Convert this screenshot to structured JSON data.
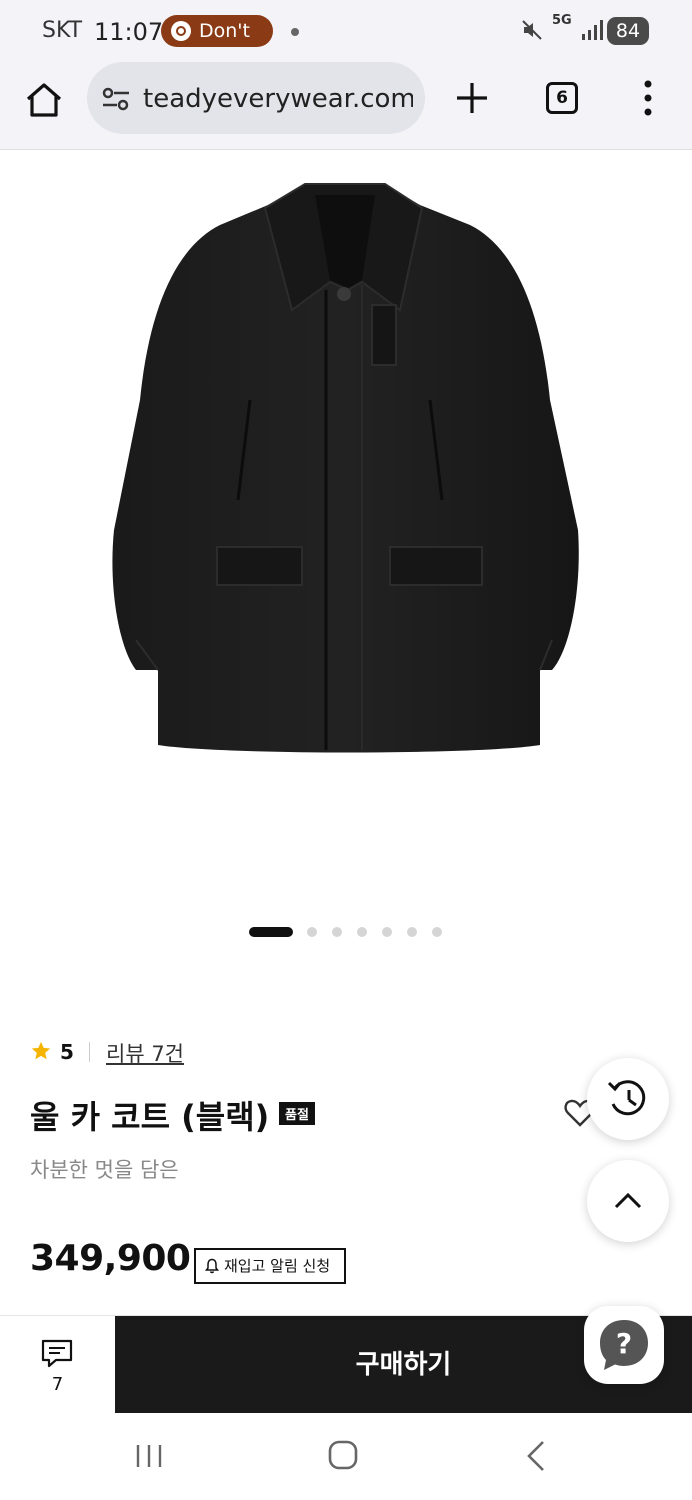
{
  "status_bar": {
    "carrier": "SKT",
    "time": "11:07",
    "notification_pill": "Don't",
    "network": "5G",
    "battery": "84"
  },
  "browser": {
    "url": "teadyeverywear.com",
    "tab_count": "6"
  },
  "carousel": {
    "total": 7,
    "active_index": 0
  },
  "product": {
    "rating": "5",
    "review_link": "리뷰 7건",
    "title": "울 카 코트 (블랙)",
    "soldout_badge": "품절",
    "subtitle": "차분한 멋을 담은",
    "price": "349,900",
    "restock_button": "재입고 알림 신청"
  },
  "action_bar": {
    "chat_count": "7",
    "buy_button": "구매하기"
  },
  "colors": {
    "star": "#f5b400",
    "buy_button_bg": "#1a1a1a",
    "notification_pill": "#8a3a14",
    "help_icon": "#555555"
  }
}
